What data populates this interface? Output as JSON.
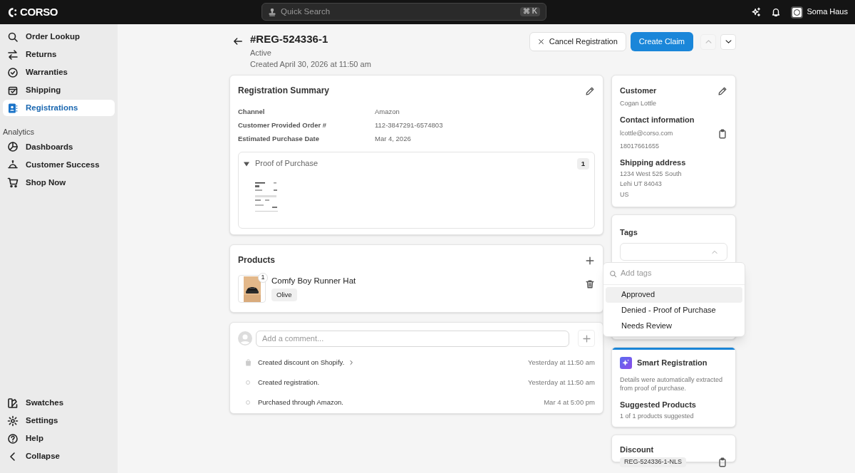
{
  "topbar": {
    "logo": "CORSO",
    "search": {
      "placeholder": "Quick Search",
      "shortcut": "⌘ K"
    },
    "user": "Soma Haus"
  },
  "sidebar": {
    "items": [
      {
        "label": "Order Lookup",
        "selected": false
      },
      {
        "label": "Returns",
        "selected": false
      },
      {
        "label": "Warranties",
        "selected": false
      },
      {
        "label": "Shipping",
        "selected": false
      },
      {
        "label": "Registrations",
        "selected": true
      }
    ],
    "section": "Analytics",
    "analytics_items": [
      {
        "label": "Dashboards",
        "selected": false
      },
      {
        "label": "Customer Success",
        "selected": false
      },
      {
        "label": "Shop Now",
        "selected": false
      }
    ],
    "footer_items": [
      {
        "label": "Swatches"
      },
      {
        "label": "Settings"
      },
      {
        "label": "Help"
      },
      {
        "label": "Collapse"
      }
    ]
  },
  "header": {
    "title": "#REG-524336-1",
    "status": "Active",
    "created": "Created April 30, 2026 at 11:50 am",
    "buttons": [
      {
        "label": "Cancel Registration",
        "kind": "secondary"
      },
      {
        "label": "Create Claim",
        "kind": "primary"
      }
    ],
    "prev_disabled": true
  },
  "registration_summary": {
    "title": "Registration Summary",
    "fields": [
      {
        "label": "Channel",
        "value": "Amazon"
      },
      {
        "label": "Customer Provided Order #",
        "value": "112-3847291-6574803"
      },
      {
        "label": "Estimated Purchase Date",
        "value": "Mar 4, 2026"
      }
    ],
    "proof": {
      "title": "Proof of Purchase",
      "count": "1",
      "expanded": true
    }
  },
  "products": {
    "title": "Products",
    "items": [
      {
        "name": "Comfy Boy Runner Hat",
        "quantity": "1",
        "variant": "Olive"
      }
    ]
  },
  "activity": {
    "comment_placeholder": "Add a comment...",
    "events": [
      {
        "text": "Created discount on Shopify.",
        "time": "Yesterday at 11:50 am",
        "kind": "shopify"
      },
      {
        "text": "Created registration.",
        "time": "Yesterday at 11:50 am",
        "kind": "dot"
      },
      {
        "text": "Purchased through Amazon.",
        "time": "Mar 4 at 5:00 pm",
        "kind": "dot"
      }
    ]
  },
  "customer": {
    "title": "Customer",
    "name": "Cogan Lottle",
    "contact_title": "Contact information",
    "email": "lcottle@corso.com",
    "phone": "18017661655",
    "shipping_title": "Shipping address",
    "address": [
      "1234 West 525 South",
      "Lehi UT 84043",
      "US"
    ]
  },
  "tags": {
    "title": "Tags",
    "dropdown": {
      "placeholder": "Add tags",
      "options": [
        {
          "label": "Approved",
          "selected": true
        },
        {
          "label": "Denied - Proof of Purchase",
          "selected": false
        },
        {
          "label": "Needs Review",
          "selected": false
        }
      ]
    }
  },
  "smart_registration": {
    "title": "Smart Registration",
    "description": "Details were automatically extracted from proof of purchase.",
    "suggested_title": "Suggested Products",
    "suggested_text": "1 of 1 products suggested"
  },
  "discount": {
    "title": "Discount",
    "code": "REG-524336-1-NLS"
  }
}
